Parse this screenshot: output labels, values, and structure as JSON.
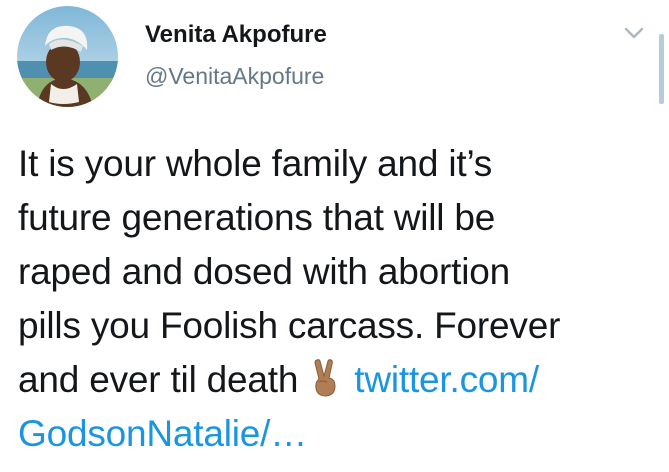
{
  "author": {
    "display_name": "Venita Akpofure",
    "handle": "@VenitaAkpofure"
  },
  "tweet": {
    "line1": "It is your whole family and it’s",
    "line2": "future generations that will be",
    "line3": "raped and dosed with abortion",
    "line4": "pills you Foolish carcass. Forever",
    "line5_text": "and ever til death",
    "emoji": "victory-hand-emoji",
    "link_part1": "twitter.com/",
    "link_part2": "GodsonNatalie/…"
  },
  "colors": {
    "text": "#14171a",
    "secondary": "#657786",
    "link": "#1b95e0"
  }
}
